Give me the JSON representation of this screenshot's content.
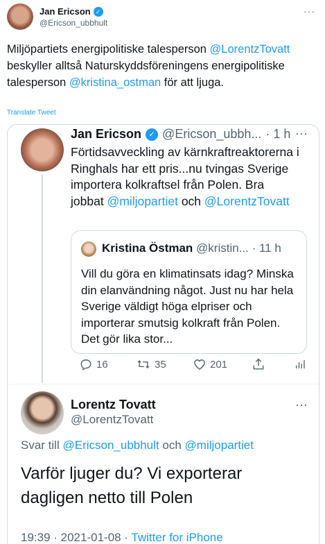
{
  "outer_tweet": {
    "name": "Jan Ericson",
    "handle": "@Ericson_ubbhult",
    "more": "···",
    "text_parts": [
      {
        "text": "Miljöpartiets energipolitiske talesperson ",
        "link": false
      },
      {
        "text": "@LorentzTovatt",
        "link": true
      },
      {
        "text": " beskyller alltså Naturskyddsföreningens energipolitiske talesperson ",
        "link": false
      },
      {
        "text": "@kristina_ostman",
        "link": true
      },
      {
        "text": " för att ljuga.",
        "link": false
      }
    ],
    "translate": "Translate Tweet"
  },
  "embedded": {
    "tweet": {
      "name": "Jan Ericson",
      "handle": "@Ericson_ubbh...",
      "time": "· 1 h",
      "more": "···",
      "text": "Förtidsavveckling av kärnkraftreaktorerna i Ringhals har ett pris...nu tvingas Sverige importera kolkraftsel från Polen. Bra jobbat",
      "mention1": "@miljopartiet",
      "and_word": "och",
      "mention2": "@LorentzTovatt"
    },
    "quote": {
      "name": "Kristina Östman",
      "handle": "@kristin...",
      "time": "· 11 h",
      "text": "Vill du göra en klimatinsats idag? Minska din elanvändning något. Just nu har hela Sverige väldigt höga elpriser och importerar smutsig kolkraft från Polen. Det gör lika stor..."
    },
    "actions": {
      "replies": "16",
      "retweets": "35",
      "likes": "201"
    },
    "reply": {
      "name": "Lorentz Tovatt",
      "handle": "@LorentzTovatt",
      "more": "···",
      "reply_prefix": "Svar till",
      "reply_user1": "@Ericson_ubbhult",
      "reply_and": "och",
      "reply_user2": "@miljopartiet",
      "text": "Varför ljuger du? Vi exporterar dagligen netto till Polen",
      "timestamp": "19:39 · 2021-01-08 · ",
      "source": "Twitter for iPhone"
    }
  },
  "colors": {
    "link": "#1d9bf0",
    "secondary": "#536471",
    "text": "#0f1419"
  }
}
